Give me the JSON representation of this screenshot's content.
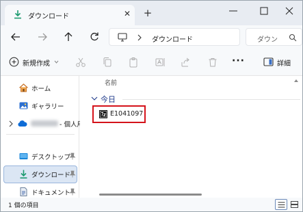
{
  "window": {
    "tab_label": "ダウンロード",
    "close_glyph": "✕",
    "new_tab_glyph": "+"
  },
  "address": {
    "current_location": "ダウンロード"
  },
  "search": {
    "placeholder": "ダウン"
  },
  "commandbar": {
    "new_label": "新規作成",
    "more_label": "···",
    "details_label": "詳細"
  },
  "sidebar": {
    "items": [
      {
        "label": "ホーム",
        "icon": "home-icon"
      },
      {
        "label": "ギャラリー",
        "icon": "gallery-icon"
      },
      {
        "label": "- 個人用",
        "icon": "cloud-icon"
      },
      {
        "label": "デスクトップ",
        "icon": "desktop-icon"
      },
      {
        "label": "ダウンロード",
        "icon": "download-icon",
        "selected": true
      },
      {
        "label": "ドキュメント",
        "icon": "documents-icon"
      }
    ]
  },
  "content": {
    "column_name": "名前",
    "group_label": "今日",
    "files": [
      {
        "name": "E1041097",
        "icon": "7z-archive-icon"
      }
    ]
  },
  "status": {
    "item_count": "1 個の項目"
  },
  "colors": {
    "accent": "#1a9a6e",
    "highlight_box": "#d4121a",
    "selected_bg": "#dbe6f4"
  }
}
